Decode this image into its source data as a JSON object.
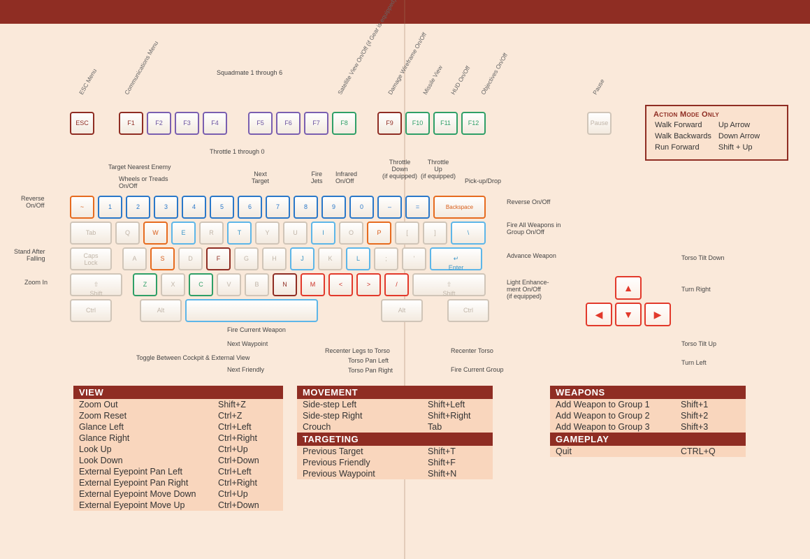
{
  "callouts": {
    "esc": "ESC Menu",
    "comm": "Communications Menu",
    "squad": "Squadmate\n1 through 6",
    "sat": "Satellite View On/Off\n(if Gear is equipped)",
    "dmg": "Damage Wireframe On/Off",
    "missile": "Missile View",
    "hud": "HUD On/Off",
    "obj": "Objectives On/Off",
    "pause": "Pause",
    "throttle": "Throttle 1 through 0",
    "tgt_near": "Target Nearest Enemy",
    "wheels": "Wheels or Treads\nOn/Off",
    "next_tgt": "Next\nTarget",
    "jets": "Fire\nJets",
    "ir": "Infrared\nOn/Off",
    "thr_dn": "Throttle\nDown\n(if equipped)",
    "thr_up": "Throttle\nUp\n(if equipped)",
    "pickup": "Pick-up/Drop",
    "reverse_l": "Reverse\nOn/Off",
    "reverse_r": "Reverse On/Off",
    "fire_all": "Fire All Weapons in\nGroup On/Off",
    "adv_wpn": "Advance Weapon",
    "light": "Light Enhance-\nment On/Off\n(if equipped)",
    "stand": "Stand After\nFalling",
    "zoomin": "Zoom In",
    "fire_cur": "Fire Current Weapon",
    "next_wp": "Next Waypoint",
    "tog_view": "Toggle Between Cockpit & External View",
    "next_frnd": "Next Friendly",
    "recenter_legs": "Recenter Legs to Torso",
    "pan_l": "Torso Pan Left",
    "pan_r": "Torso Pan Right",
    "recenter_torso": "Recenter Torso",
    "fire_grp": "Fire Current Group",
    "tiltdn": "Torso Tilt Down",
    "turnr": "Turn Right",
    "tiltup": "Torso Tilt Up",
    "turnl": "Turn Left"
  },
  "keys": {
    "esc": "ESC",
    "f1": "F1",
    "f2": "F2",
    "f3": "F3",
    "f4": "F4",
    "f5": "F5",
    "f6": "F6",
    "f7": "F7",
    "f8": "F8",
    "f9": "F9",
    "f10": "F10",
    "f11": "F11",
    "f12": "F12",
    "pause": "Pause",
    "tilde": "~",
    "k1": "1",
    "k2": "2",
    "k3": "3",
    "k4": "4",
    "k5": "5",
    "k6": "6",
    "k7": "7",
    "k8": "8",
    "k9": "9",
    "k0": "0",
    "minus": "–",
    "equals": "=",
    "bksp": "Backspace",
    "tab": "Tab",
    "q": "Q",
    "w": "W",
    "e": "E",
    "r": "R",
    "t": "T",
    "y": "Y",
    "u": "U",
    "i": "I",
    "o": "O",
    "p": "P",
    "lb": "[",
    "rb": "]",
    "bslash": "\\",
    "caps": "Caps\nLock",
    "a": "A",
    "s": "S",
    "d": "D",
    "f": "F",
    "g": "G",
    "h": "H",
    "j": "J",
    "k": "K",
    "l": "L",
    "semi": ";",
    "quote": "'",
    "enter": "Enter",
    "lshift": "Shift",
    "z": "Z",
    "x": "X",
    "c": "C",
    "v": "V",
    "b": "B",
    "n": "N",
    "m": "M",
    "comma": "<",
    "period": ">",
    "slash": "/",
    "rshift": "Shift",
    "lctrl": "Ctrl",
    "lalt": "Alt",
    "space": "",
    "ralt": "Alt",
    "rctrl": "Ctrl"
  },
  "actionMode": {
    "title": "Action Mode Only",
    "rows": [
      {
        "a": "Walk Forward",
        "b": "Up Arrow"
      },
      {
        "a": "Walk Backwards",
        "b": "Down Arrow"
      },
      {
        "a": "Run Forward",
        "b": "Shift + Up"
      }
    ]
  },
  "panels": {
    "view": {
      "title": "VIEW",
      "rows": [
        {
          "a": "Zoom Out",
          "b": "Shift+Z"
        },
        {
          "a": "Zoom Reset",
          "b": "Ctrl+Z"
        },
        {
          "a": "Glance Left",
          "b": "Ctrl+Left"
        },
        {
          "a": "Glance Right",
          "b": "Ctrl+Right"
        },
        {
          "a": "Look Up",
          "b": "Ctrl+Up"
        },
        {
          "a": "Look Down",
          "b": "Ctrl+Down"
        },
        {
          "a": "External Eyepoint Pan Left",
          "b": "Ctrl+Left"
        },
        {
          "a": "External Eyepoint Pan Right",
          "b": "Ctrl+Right"
        },
        {
          "a": "External Eyepoint Move Down",
          "b": "Ctrl+Up"
        },
        {
          "a": "External Eyepoint Move Up",
          "b": "Ctrl+Down"
        }
      ]
    },
    "movement": {
      "title": "MOVEMENT",
      "rows": [
        {
          "a": "Side-step Left",
          "b": "Shift+Left"
        },
        {
          "a": "Side-step Right",
          "b": "Shift+Right"
        },
        {
          "a": "Crouch",
          "b": "Tab"
        }
      ]
    },
    "targeting": {
      "title": "TARGETING",
      "rows": [
        {
          "a": "Previous Target",
          "b": "Shift+T"
        },
        {
          "a": "Previous Friendly",
          "b": "Shift+F"
        },
        {
          "a": "Previous Waypoint",
          "b": "Shift+N"
        }
      ]
    },
    "weapons": {
      "title": "WEAPONS",
      "rows": [
        {
          "a": "Add Weapon to Group 1",
          "b": "Shift+1"
        },
        {
          "a": "Add Weapon to Group 2",
          "b": "Shift+2"
        },
        {
          "a": "Add Weapon to Group 3",
          "b": "Shift+3"
        }
      ]
    },
    "gameplay": {
      "title": "GAMEPLAY",
      "rows": [
        {
          "a": "Quit",
          "b": "CTRL+Q"
        }
      ]
    }
  }
}
